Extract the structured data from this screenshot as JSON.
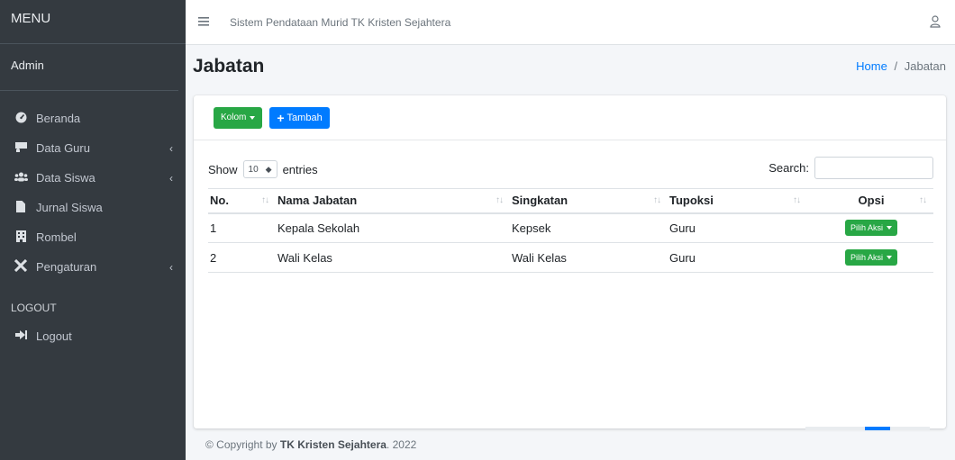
{
  "sidebar": {
    "brand": "MENU",
    "user": "Admin",
    "items": [
      {
        "label": "Beranda",
        "icon": "tachometer-icon",
        "chevron": ""
      },
      {
        "label": "Data Guru",
        "icon": "teacher-icon",
        "chevron": "‹"
      },
      {
        "label": "Data Siswa",
        "icon": "users-icon",
        "chevron": "‹"
      },
      {
        "label": "Jurnal Siswa",
        "icon": "file-icon",
        "chevron": ""
      },
      {
        "label": "Rombel",
        "icon": "building-icon",
        "chevron": ""
      },
      {
        "label": "Pengaturan",
        "icon": "tools-icon",
        "chevron": "‹"
      }
    ],
    "section_header": "LOGOUT",
    "logout": "Logout"
  },
  "topbar": {
    "title": "Sistem Pendataan Murid TK Kristen Sejahtera"
  },
  "page": {
    "title": "Jabatan",
    "breadcrumb_home": "Home",
    "breadcrumb_sep": "/",
    "breadcrumb_current": "Jabatan"
  },
  "card": {
    "kolom_label": "Kolom",
    "tambah_label": "Tambah",
    "show_label": "Show",
    "entries_value": "10",
    "entries_label": "entries",
    "search_label": "Search:",
    "search_value": ""
  },
  "table": {
    "headers": [
      "No.",
      "Nama Jabatan",
      "Singkatan",
      "Tupoksi",
      "Opsi"
    ],
    "rows": [
      {
        "no": "1",
        "nama": "Kepala Sekolah",
        "singkatan": "Kepsek",
        "tupoksi": "Guru",
        "aksi": "Pilih Aksi"
      },
      {
        "no": "2",
        "nama": "Wali Kelas",
        "singkatan": "Wali Kelas",
        "tupoksi": "Guru",
        "aksi": "Pilih Aksi"
      }
    ]
  },
  "footer": {
    "prefix": "© Copyright by ",
    "org": "TK Kristen Sejahtera",
    "suffix": ". 2022"
  },
  "colors": {
    "sidebar_bg": "#343a40",
    "primary": "#007bff",
    "success": "#28a745"
  }
}
